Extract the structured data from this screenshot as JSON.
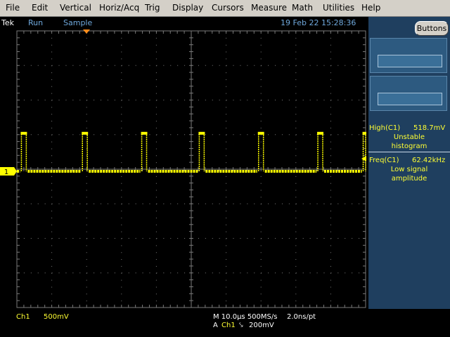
{
  "menubar": {
    "items": [
      {
        "label": "File"
      },
      {
        "label": "Edit"
      },
      {
        "label": "Vertical"
      },
      {
        "label": "Horiz/Acq"
      },
      {
        "label": "Trig"
      },
      {
        "label": "Display"
      },
      {
        "label": "Cursors"
      },
      {
        "label": "Measure"
      },
      {
        "label": "Math"
      },
      {
        "label": "Utilities"
      },
      {
        "label": "Help"
      }
    ]
  },
  "status": {
    "brand": "Tek",
    "run_state": "Run",
    "acq_mode": "Sample",
    "datetime": "19 Feb 22 15:28:36"
  },
  "right_panel": {
    "buttons_label": "Buttons",
    "measurements": [
      {
        "label": "High(C1)",
        "value": "518.7mV",
        "status_line1": "Unstable",
        "status_line2": "histogram"
      },
      {
        "label": "Freq(C1)",
        "value": "62.42kHz",
        "status_line1": "Low signal",
        "status_line2": "amplitude"
      }
    ]
  },
  "channel_marker": "1",
  "bottom": {
    "ch_label": "Ch1",
    "ch_scale": "500mV",
    "timebase": "M 10.0µs 500MS/s",
    "sample_interval": "2.0ns/pt",
    "trig_prefix": "A",
    "trig_source": "Ch1",
    "trig_slope_symbol": "⤥",
    "trig_level": "200mV"
  },
  "colors": {
    "trace": "#ffff00",
    "grid": "#7a7a7a",
    "panel": "#1f3f5f",
    "menubar": "#d4d0c8",
    "trigger_marker": "#ff8c1a"
  },
  "chart_data": {
    "type": "line",
    "title": "",
    "xlabel": "",
    "ylabel": "",
    "x_divisions": 10,
    "y_divisions": 8,
    "x_unit_per_div": "10.0µs",
    "y_unit_per_div": "500mV",
    "series": [
      {
        "baseline_div": 0,
        "pulse_high_div": 1.1,
        "pulse_width_div": 0.14,
        "pulse_positions_div": [
          0.2,
          1.95,
          3.65,
          5.3,
          7.0,
          8.7,
          10.0
        ]
      }
    ]
  }
}
